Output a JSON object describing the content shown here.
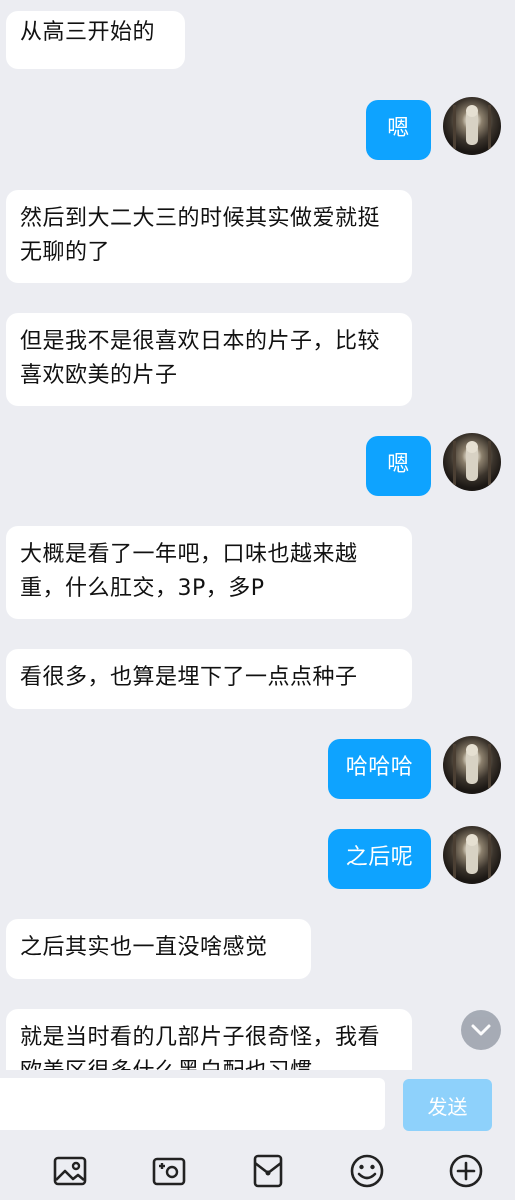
{
  "messages": [
    {
      "side": "left",
      "text": "从高三开始的"
    },
    {
      "side": "right",
      "text": "嗯"
    },
    {
      "side": "left",
      "text": "然后到大二大三的时候其实做爱就挺无聊的了"
    },
    {
      "side": "left",
      "text": "但是我不是很喜欢日本的片子，比较喜欢欧美的片子"
    },
    {
      "side": "right",
      "text": "嗯"
    },
    {
      "side": "left",
      "text": "大概是看了一年吧，口味也越来越重，什么肛交，3P，多P"
    },
    {
      "side": "left",
      "text": "看很多，也算是埋下了一点点种子"
    },
    {
      "side": "right",
      "text": "哈哈哈"
    },
    {
      "side": "right",
      "text": "之后呢"
    },
    {
      "side": "left",
      "text": "之后其实也一直没啥感觉"
    },
    {
      "side": "left",
      "text": "就是当时看的几部片子很奇怪，我看欧美区很多什么黑白配也习惯"
    }
  ],
  "input": {
    "value": "",
    "placeholder": ""
  },
  "send_label": "发送",
  "toolbar": {
    "icons": [
      "image-icon",
      "camera-icon",
      "red-packet-icon",
      "emoji-icon",
      "plus-icon"
    ]
  },
  "colors": {
    "background": "#ecedf2",
    "outgoing_bubble": "#0ea3ff",
    "incoming_bubble": "#ffffff",
    "send_button": "#8ed1fb"
  }
}
